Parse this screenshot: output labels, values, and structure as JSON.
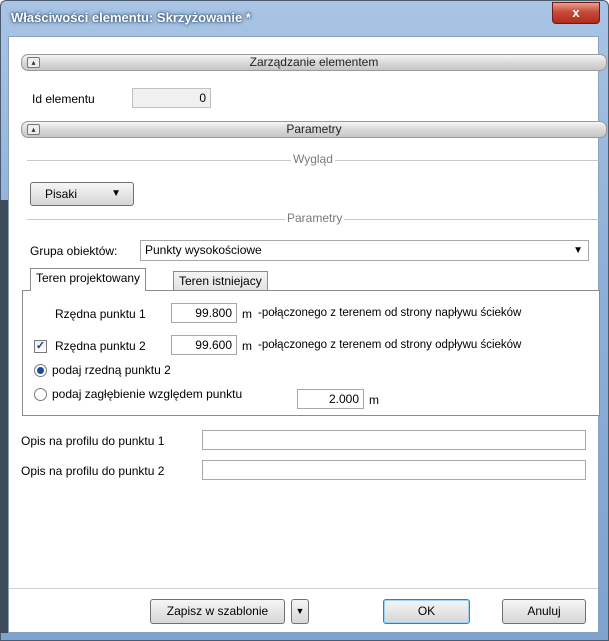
{
  "window": {
    "title": "Właściwości elementu: Skrzyżowanie *",
    "close_label": "x"
  },
  "sections": {
    "zarzadzanie": "Zarządzanie elementem",
    "parametry": "Parametry"
  },
  "element_id": {
    "label": "Id elementu",
    "value": "0"
  },
  "wyglad": {
    "title": "Wygląd",
    "pens_button": "Pisaki"
  },
  "parametry_group": {
    "title": "Parametry"
  },
  "grupa": {
    "label": "Grupa obiektów:",
    "value": "Punkty wysokościowe"
  },
  "tabs": [
    {
      "label": "Teren projektowany"
    },
    {
      "label": "Teren istniejacy"
    }
  ],
  "rzedna1": {
    "label": "Rzędna punktu 1",
    "value": "99.800",
    "unit": "m",
    "note": "-połączonego z terenem od strony napływu ścieków"
  },
  "rzedna2": {
    "label": "Rzędna punktu 2",
    "value": "99.600",
    "unit": "m",
    "note": "-połączonego z terenem od strony odpływu ścieków",
    "checked": true
  },
  "radio1": {
    "label": "podaj rzedną punktu 2",
    "selected": true
  },
  "radio2": {
    "label": "podaj zagłębienie względem punktu",
    "value": "2.000",
    "unit": "m",
    "selected": false
  },
  "opis1": {
    "label": "Opis na profilu do punktu 1",
    "value": ""
  },
  "opis2": {
    "label": "Opis na profilu do punktu 2",
    "value": ""
  },
  "footer": {
    "save_template": "Zapisz w szablonie",
    "ok": "OK",
    "cancel": "Anuluj"
  },
  "icons": {
    "collapse": "chevron-up-icon",
    "dropdown": "chevron-down-icon",
    "check": "checkmark-icon"
  }
}
